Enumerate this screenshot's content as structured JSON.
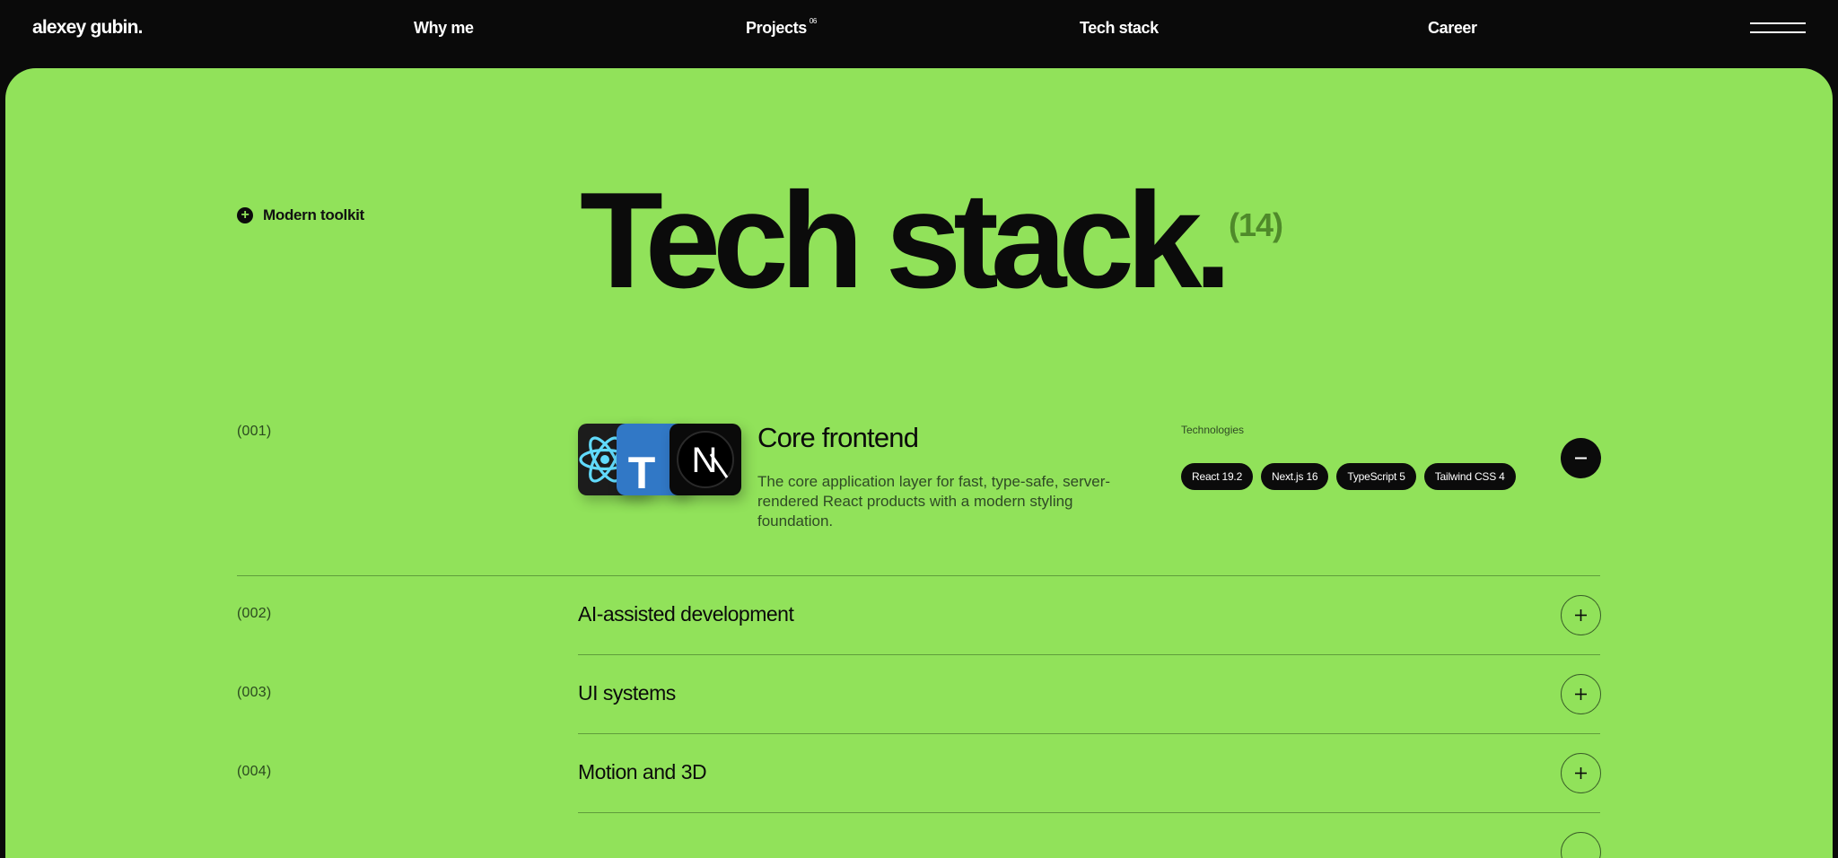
{
  "header": {
    "logo": "alexey gubin.",
    "nav": [
      {
        "label": "Why me"
      },
      {
        "label": "Projects",
        "sup": "06"
      },
      {
        "label": "Tech stack"
      },
      {
        "label": "Career"
      }
    ]
  },
  "section": {
    "eyebrow": "Modern toolkit",
    "title": "Tech stack.",
    "count": "(14)"
  },
  "categories": [
    {
      "number": "(001)",
      "title": "Core frontend",
      "description": "The core application layer for fast, type-safe, server-rendered React products with a modern styling foundation.",
      "tech_label": "Technologies",
      "technologies": [
        "React 19.2",
        "Next.js 16",
        "TypeScript 5",
        "Tailwind CSS 4"
      ],
      "expanded": true,
      "logos": [
        "react-icon",
        "typescript-icon",
        "nextjs-icon"
      ],
      "logo_letters": {
        "typescript": "T",
        "next": "N"
      }
    },
    {
      "number": "(002)",
      "title": "AI-assisted development",
      "expanded": false
    },
    {
      "number": "(003)",
      "title": "UI systems",
      "expanded": false
    },
    {
      "number": "(004)",
      "title": "Motion and 3D",
      "expanded": false
    }
  ],
  "colors": {
    "background": "#0a0a0a",
    "panel": "#91e25a",
    "count": "#4f8a2a",
    "react": "#61dafb",
    "typescript": "#3178c6"
  }
}
